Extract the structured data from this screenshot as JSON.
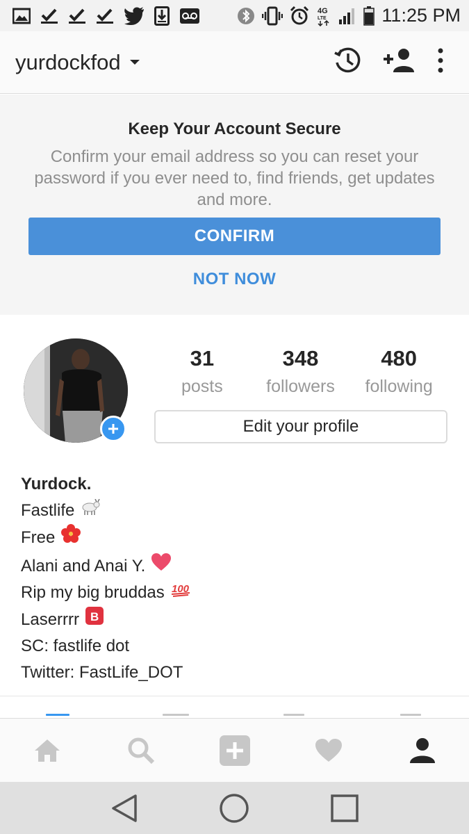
{
  "status_bar": {
    "time": "11:25 PM",
    "network": "4G LTE",
    "left_icons": [
      "image-icon",
      "checkmark-icon",
      "checkmark-icon",
      "checkmark-icon",
      "twitter-icon",
      "download-icon",
      "voicemail-icon"
    ],
    "right_icons": [
      "bluetooth-icon",
      "vibrate-icon",
      "alarm-icon",
      "signal-icon",
      "battery-icon"
    ]
  },
  "header": {
    "username": "yurdockfod",
    "icons": [
      "history-icon",
      "add-person-icon",
      "more-vertical-icon"
    ]
  },
  "banner": {
    "title": "Keep Your Account Secure",
    "body": "Confirm your email address so you can reset your password if you ever need to, find friends, get updates and more.",
    "confirm_label": "CONFIRM",
    "not_now_label": "NOT NOW",
    "accent_color": "#4a90d9"
  },
  "profile": {
    "stats": [
      {
        "value": "31",
        "label": "posts"
      },
      {
        "value": "348",
        "label": "followers"
      },
      {
        "value": "480",
        "label": "following"
      }
    ],
    "edit_label": "Edit your profile",
    "bio": {
      "name": "Yurdock.",
      "lines": [
        {
          "text": "Fastlife",
          "emoji": "goat"
        },
        {
          "text": "Free",
          "emoji": "hibiscus"
        },
        {
          "text": "Alani and Anai Y.",
          "emoji": "heart"
        },
        {
          "text": "Rip my big bruddas",
          "emoji": "hundred"
        },
        {
          "text": "Laserrrr",
          "emoji": "b-button"
        },
        {
          "text": "SC: fastlife dot",
          "emoji": ""
        },
        {
          "text": "Twitter: FastLife_DOT",
          "emoji": ""
        }
      ]
    }
  },
  "bottom_nav": [
    "home-icon",
    "search-icon",
    "add-post-icon",
    "activity-heart-icon",
    "profile-icon"
  ],
  "system_nav": [
    "back-icon",
    "home-circle-icon",
    "recents-icon"
  ]
}
